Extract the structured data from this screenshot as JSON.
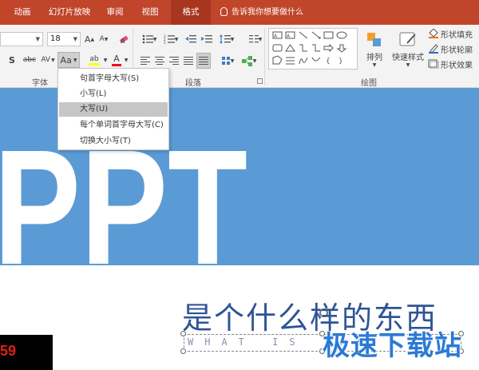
{
  "tabs": [
    {
      "label": "动画",
      "active": false
    },
    {
      "label": "幻灯片放映",
      "active": false
    },
    {
      "label": "审阅",
      "active": false
    },
    {
      "label": "视图",
      "active": false
    },
    {
      "label": "格式",
      "active": true
    }
  ],
  "tell_me": "告诉我你想要做什么",
  "font": {
    "size": "18",
    "grow_label": "A",
    "shrink_label": "A",
    "strikethrough_label": "abc",
    "spacing_label": "AV",
    "case_label": "Aa",
    "font_color_label": "A",
    "highlight_label": "ab"
  },
  "groups": {
    "font": "字体",
    "paragraph": "段落",
    "drawing": "绘图"
  },
  "drawing": {
    "arrange": "排列",
    "quick_styles": "快速样式",
    "shape_fill": "形状填充",
    "shape_outline": "形状轮廓",
    "shape_effects": "形状效果"
  },
  "change_case_menu": [
    {
      "label": "句首字母大写(S)",
      "highlighted": false
    },
    {
      "label": "小写(L)",
      "highlighted": false
    },
    {
      "label": "大写(U)",
      "highlighted": true
    },
    {
      "label": "每个单词首字母大写(C)",
      "highlighted": false
    },
    {
      "label": "切换大小写(T)",
      "highlighted": false
    }
  ],
  "slide": {
    "big_text": "PPT",
    "title": "是个什么样的东西",
    "subtitle": "WHAT IS THE"
  },
  "watermark": {
    "text": "极速下载站",
    "logo_text": "59"
  },
  "colors": {
    "tab_bar": "#c1452b",
    "slide_bg": "#5b9bd5",
    "title": "#2f5496",
    "font_color_bar": "#e81123",
    "highlight_bar": "#ffff00"
  }
}
